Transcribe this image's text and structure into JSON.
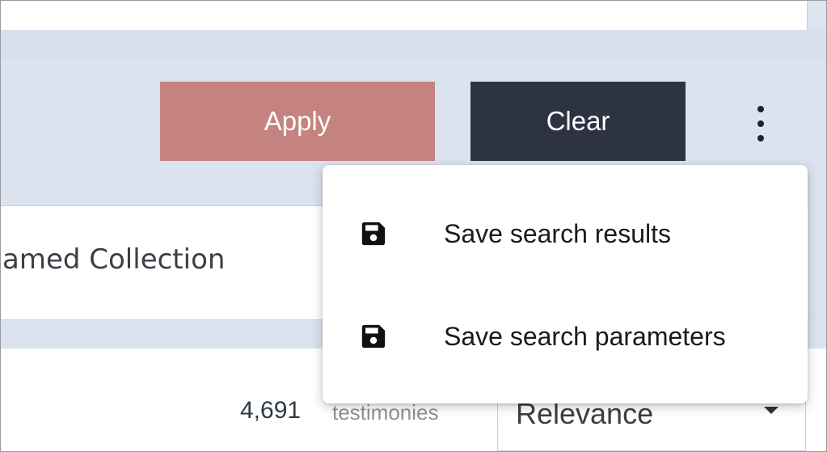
{
  "toolbar": {
    "apply_label": "Apply",
    "clear_label": "Clear",
    "apply_color": "#c4837f",
    "clear_color": "#2e3343",
    "more_icon": "kebab-vertical-icon"
  },
  "collection": {
    "name": "amed Collection"
  },
  "results": {
    "count": "4,691",
    "count_label": "testimonies",
    "sort_value": "Relevance"
  },
  "menu": {
    "items": [
      {
        "label": "Save search results",
        "icon": "floppy-disk-icon"
      },
      {
        "label": "Save search parameters",
        "icon": "floppy-disk-icon"
      }
    ]
  }
}
